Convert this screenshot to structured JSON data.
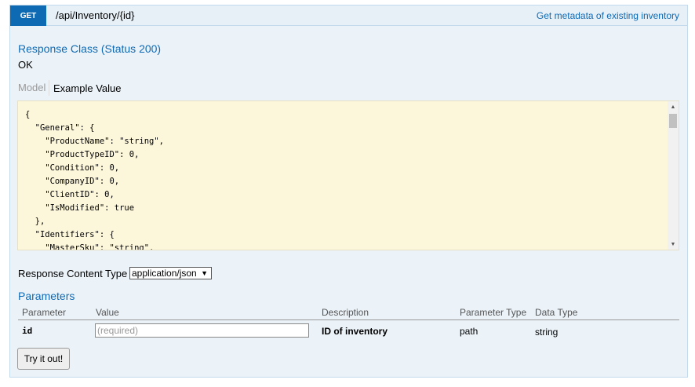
{
  "endpoint": {
    "method": "GET",
    "path": "/api/Inventory/{id}",
    "summary": "Get metadata of existing inventory"
  },
  "response_class": {
    "title": "Response Class (Status 200)",
    "status_text": "OK"
  },
  "signature_tabs": {
    "model_label": "Model",
    "example_label": "Example Value"
  },
  "example_json": "{\n  \"General\": {\n    \"ProductName\": \"string\",\n    \"ProductTypeID\": 0,\n    \"Condition\": 0,\n    \"CompanyID\": 0,\n    \"ClientID\": 0,\n    \"IsModified\": true\n  },\n  \"Identifiers\": {\n    \"MasterSku\": \"string\",",
  "scrollbar": {
    "up_glyph": "▲",
    "down_glyph": "▼"
  },
  "response_content_type": {
    "label": "Response Content Type",
    "selected": "application/json",
    "caret": "▼"
  },
  "parameters": {
    "title": "Parameters",
    "headers": [
      "Parameter",
      "Value",
      "Description",
      "Parameter Type",
      "Data Type"
    ],
    "rows": [
      {
        "name": "id",
        "placeholder": "(required)",
        "description": "ID of inventory",
        "param_type": "path",
        "data_type": "string"
      }
    ]
  },
  "try_button": "Try it out!",
  "colors": {
    "accent": "#0f6ab4",
    "panel_bg": "#ebf3f9",
    "code_bg": "#fcf6db"
  }
}
